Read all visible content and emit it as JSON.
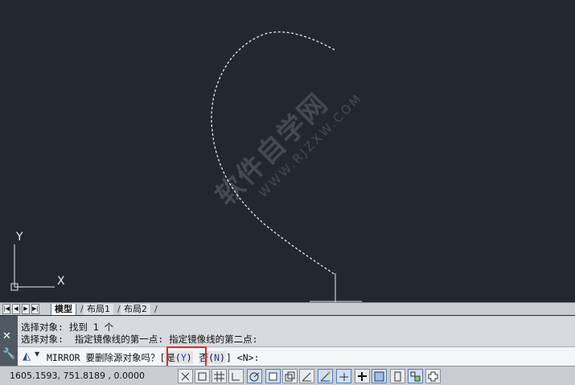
{
  "tabs": [
    {
      "label": "模型",
      "active": true
    },
    {
      "label": "布局1",
      "active": false
    },
    {
      "label": "布局2",
      "active": false
    }
  ],
  "nav_buttons": [
    "first-icon",
    "prev-icon",
    "next-icon",
    "last-icon"
  ],
  "ucs": {
    "x_label": "X",
    "y_label": "Y"
  },
  "watermark": {
    "main": "软件自学网",
    "sub": "WWW.RJZXW.COM"
  },
  "command": {
    "history": [
      "选择对象: 找到 1 个",
      "选择对象:  指定镜像线的第一点: 指定镜像线的第二点:"
    ],
    "prompt_prefix": "MIRROR 要删除源对象吗？[",
    "option_yes_text": "是(",
    "option_yes_key": "Y",
    "option_yes_close": ")",
    "option_no_text": "否(",
    "option_no_key": "N",
    "option_no_close": ")",
    "prompt_suffix": "] <N>:",
    "icons": {
      "command_icon": "mirror-icon",
      "close": "close-icon",
      "customize": "wrench-icon"
    }
  },
  "statusbar": {
    "coordinates": "1605.1593, 751.8189 , 0.0000",
    "buttons": [
      "infer-icon",
      "snap-icon",
      "grid-icon",
      "ortho-icon",
      "polar-icon",
      "osnap-icon",
      "3dosnap-icon",
      "otrack-icon",
      "ducs-icon",
      "dyn-icon",
      "lineweight-icon",
      "transparency-icon",
      "qp-icon",
      "sc-icon",
      "am-icon"
    ]
  },
  "colors": {
    "canvas": "#212830",
    "highlight": "#e8262a",
    "option_key": "#1f3ea8"
  }
}
